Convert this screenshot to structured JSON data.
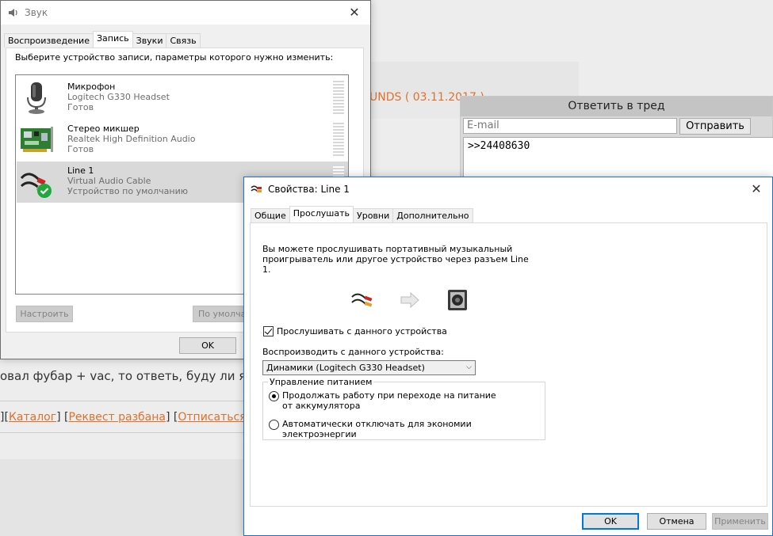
{
  "background": {
    "board_title_fragment": "UNDS ( 03.11.2017 )",
    "reply_form": {
      "title": "Ответить в тред",
      "email_placeholder": "E-mail",
      "send_label": "Отправить",
      "message_value": ">>24408630"
    },
    "post_text": "овал фубар + vac, то ответь, буду ли я сл",
    "links": [
      {
        "label": "Каталог"
      },
      {
        "label": "Реквест разбана"
      },
      {
        "label": "Отписаться от т"
      }
    ]
  },
  "sound_window": {
    "title": "Звук",
    "tabs": [
      {
        "label": "Воспроизведение",
        "active": false
      },
      {
        "label": "Запись",
        "active": true
      },
      {
        "label": "Звуки",
        "active": false
      },
      {
        "label": "Связь",
        "active": false
      }
    ],
    "prompt": "Выберите устройство записи, параметры которого нужно изменить:",
    "devices": [
      {
        "name": "Микрофон",
        "driver": "Logitech G330 Headset",
        "status": "Готов",
        "icon": "microphone-icon",
        "selected": false
      },
      {
        "name": "Стерео микшер",
        "driver": "Realtek High Definition Audio",
        "status": "Готов",
        "icon": "sound-card-icon",
        "selected": false
      },
      {
        "name": "Line 1",
        "driver": "Virtual Audio Cable",
        "status": "Устройство по умолчанию",
        "icon": "audio-cable-icon",
        "selected": true
      }
    ],
    "configure_label": "Настроить",
    "default_label": "По умолча",
    "ok_label": "OK"
  },
  "props_window": {
    "title": "Свойства: Line 1",
    "tabs": [
      {
        "label": "Общие",
        "active": false
      },
      {
        "label": "Прослушать",
        "active": true
      },
      {
        "label": "Уровни",
        "active": false
      },
      {
        "label": "Дополнительно",
        "active": false
      }
    ],
    "description": "Вы можете прослушивать портативный музыкальный проигрыватель или другое устройство через разъем Line 1.",
    "listen_checkbox_label": "Прослушивать с данного устройства",
    "listen_checked": true,
    "playback_label": "Воспроизводить с данного устройства:",
    "playback_device": "Динамики (Logitech G330 Headset)",
    "power_group_label": "Управление питанием",
    "power_options": [
      {
        "label": "Продолжать работу при переходе на питание от аккумулятора",
        "selected": true
      },
      {
        "label": "Автоматически отключать для экономии электроэнергии",
        "selected": false
      }
    ],
    "ok_label": "OK",
    "cancel_label": "Отмена",
    "apply_label": "Применить"
  },
  "colors": {
    "accent_blue": "#0078d7",
    "link_orange": "#e2702a",
    "status_green": "#1fa83c"
  }
}
